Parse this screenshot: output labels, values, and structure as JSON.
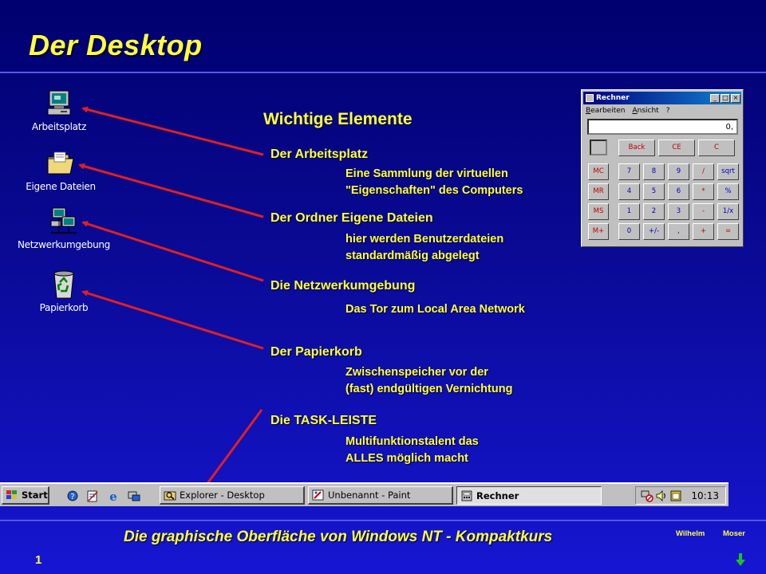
{
  "slide": {
    "title": "Der Desktop",
    "heading": "Wichtige Elemente",
    "footer": "Die graphische Oberfläche von Windows NT - Kompaktkurs",
    "author_first": "Wilhelm",
    "author_last": "Moser",
    "page_number": "1"
  },
  "desktop_icons": [
    {
      "label": "Arbeitsplatz",
      "icon": "computer-icon"
    },
    {
      "label": "Eigene Dateien",
      "icon": "folder-icon"
    },
    {
      "label": "Netzwerkumgebung",
      "icon": "network-icon"
    },
    {
      "label": "Papierkorb",
      "icon": "recycle-bin-icon"
    }
  ],
  "items": [
    {
      "title": "Der Arbeitsplatz",
      "desc": [
        "Eine Sammlung der virtuellen",
        "\"Eigenschaften\" des Computers"
      ]
    },
    {
      "title": "Der Ordner Eigene Dateien",
      "desc": [
        "hier werden Benutzerdateien",
        "standardmäßig abgelegt"
      ]
    },
    {
      "title": "Die Netzwerkumgebung",
      "desc": [
        "Das Tor zum Local Area Network"
      ]
    },
    {
      "title": "Der Papierkorb",
      "desc": [
        "Zwischenspeicher vor der",
        "(fast) endgültigen Vernichtung"
      ]
    },
    {
      "title": "Die TASK-LEISTE",
      "desc": [
        "Multifunktionstalent das",
        "ALLES möglich macht"
      ]
    }
  ],
  "calculator": {
    "title": "Rechner",
    "menu": [
      "Bearbeiten",
      "Ansicht",
      "?"
    ],
    "display": "0,",
    "top_keys": [
      "Back",
      "CE",
      "C"
    ],
    "memory_keys": [
      "MC",
      "MR",
      "MS",
      "M+"
    ],
    "rows": [
      [
        "7",
        "8",
        "9",
        "/",
        "sqrt"
      ],
      [
        "4",
        "5",
        "6",
        "*",
        "%"
      ],
      [
        "1",
        "2",
        "3",
        "-",
        "1/x"
      ],
      [
        "0",
        "+/-",
        ",",
        "+",
        "="
      ]
    ]
  },
  "taskbar": {
    "start_label": "Start",
    "tasks": [
      {
        "label": "Explorer - Desktop",
        "active": false
      },
      {
        "label": "Unbenannt - Paint",
        "active": false
      },
      {
        "label": "Rechner",
        "active": true
      }
    ],
    "clock": "10:13"
  },
  "colors": {
    "accent_text": "#ffff40",
    "arrow": "#e02020",
    "background_top": "#00006e",
    "background_bottom": "#1616d2"
  }
}
